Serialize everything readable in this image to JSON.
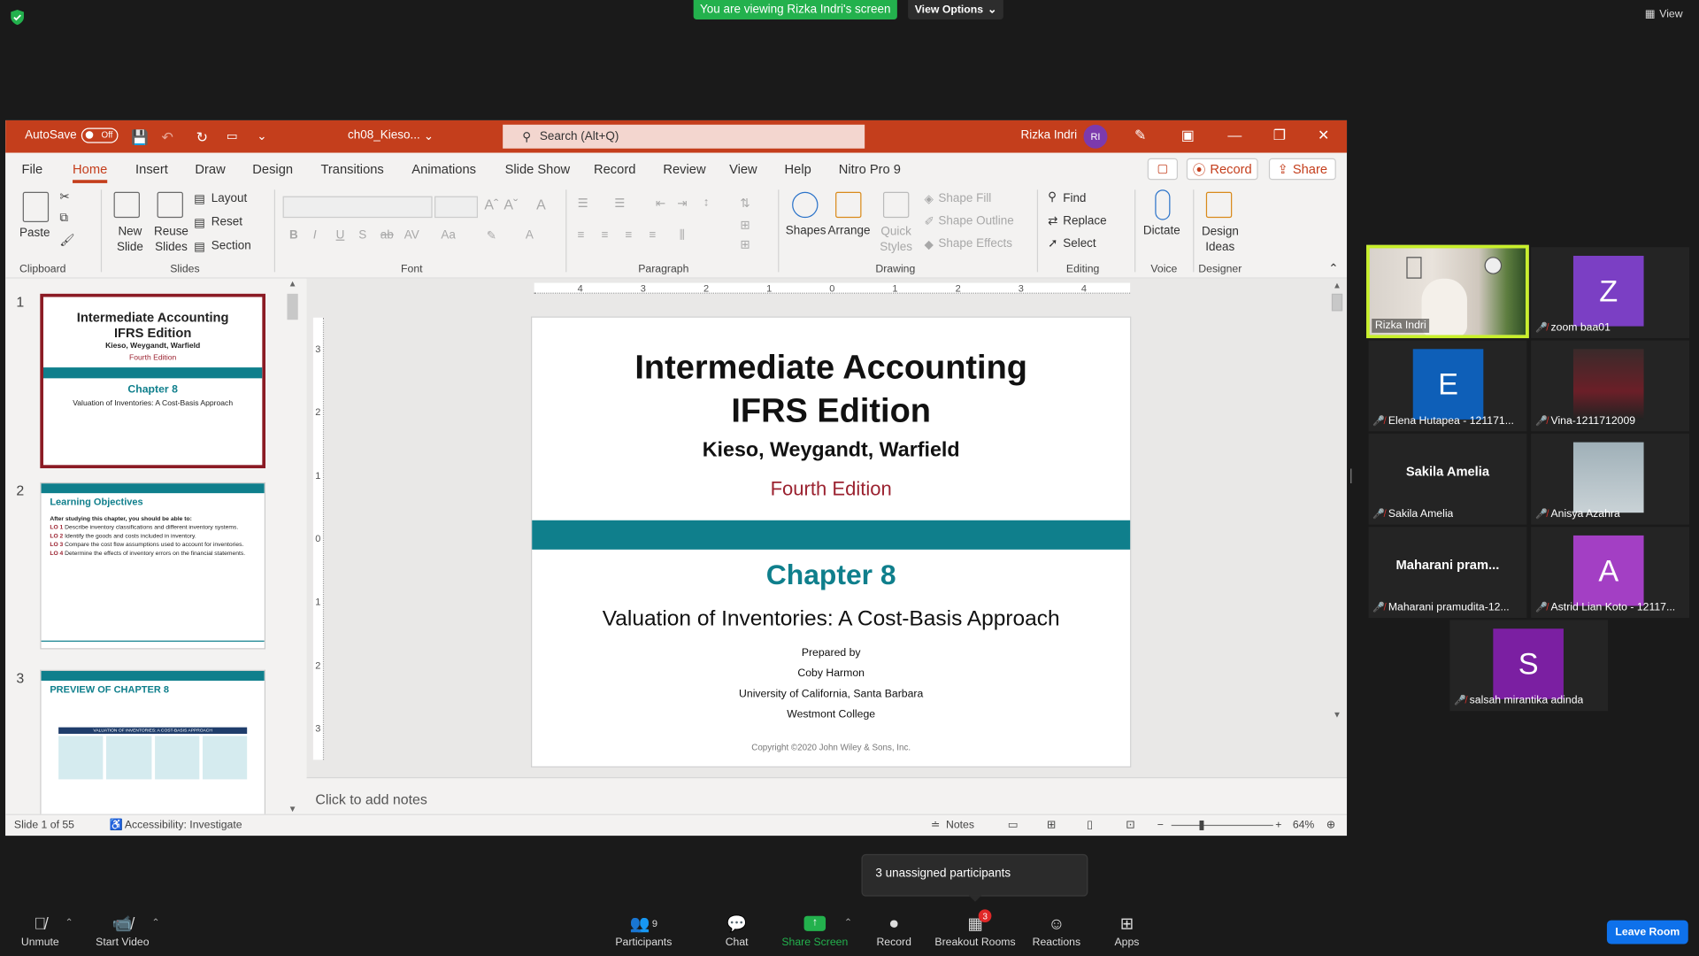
{
  "zoom": {
    "screen_banner": "You are viewing Rizka Indri's screen",
    "view_options": "View Options",
    "view_label": "View",
    "tooltip": "3 unassigned participants",
    "leave_room": "Leave Room",
    "toolbar": {
      "unmute": "Unmute",
      "start_video": "Start Video",
      "participants": "Participants",
      "participants_count": "9",
      "chat": "Chat",
      "share_screen": "Share Screen",
      "record": "Record",
      "breakout_rooms": "Breakout Rooms",
      "breakout_badge": "3",
      "reactions": "Reactions",
      "apps": "Apps"
    },
    "participants": [
      {
        "name": "Rizka Indri",
        "type": "video",
        "active": true
      },
      {
        "name": "zoom baa01",
        "letter": "Z",
        "color": "#7b3fc4",
        "muted": true
      },
      {
        "name": "Elena Hutapea - 121171...",
        "letter": "E",
        "color": "#0e5fb8",
        "muted": true
      },
      {
        "name": "Vina-1211712009",
        "type": "photo",
        "muted": true
      },
      {
        "name": "Sakila Amelia",
        "display": "Sakila Amelia",
        "muted": true
      },
      {
        "name": "Anisya Azahra",
        "type": "photo",
        "muted": true
      },
      {
        "name": "Maharani pramudita-12...",
        "display": "Maharani  pram...",
        "muted": true
      },
      {
        "name": "Astrid Lian Koto - 12117...",
        "letter": "A",
        "color": "#a33fc4",
        "muted": true
      },
      {
        "name": "salsah mirantika adinda",
        "letter": "S",
        "color": "#7b1fa2",
        "muted": true
      }
    ]
  },
  "ppt": {
    "autosave_label": "AutoSave",
    "autosave_state": "Off",
    "filename": "ch08_Kieso...",
    "search_placeholder": "Search (Alt+Q)",
    "user_name": "Rizka Indri",
    "user_initials": "RI",
    "menu": [
      "File",
      "Home",
      "Insert",
      "Draw",
      "Design",
      "Transitions",
      "Animations",
      "Slide Show",
      "Record",
      "Review",
      "View",
      "Help",
      "Nitro Pro 9"
    ],
    "record_btn": "Record",
    "share_btn": "Share",
    "ribbon": {
      "paste": "Paste",
      "clipboard": "Clipboard",
      "new_slide": "New Slide",
      "reuse_slides": "Reuse Slides",
      "layout": "Layout",
      "reset": "Reset",
      "section": "Section",
      "slides": "Slides",
      "font": "Font",
      "paragraph": "Paragraph",
      "shapes": "Shapes",
      "arrange": "Arrange",
      "quick_styles": "Quick Styles",
      "shape_fill": "Shape Fill",
      "shape_outline": "Shape Outline",
      "shape_effects": "Shape Effects",
      "drawing": "Drawing",
      "find": "Find",
      "replace": "Replace",
      "select": "Select",
      "editing": "Editing",
      "dictate": "Dictate",
      "voice": "Voice",
      "design_ideas": "Design Ideas",
      "designer": "Designer"
    },
    "thumbnails": [
      {
        "num": "1",
        "title": "Intermediate Accounting IFRS Edition",
        "authors": "Kieso, Weygandt, Warfield",
        "edition": "Fourth Edition",
        "chapter": "Chapter 8",
        "subtitle": "Valuation of Inventories: A Cost-Basis Approach"
      },
      {
        "num": "2",
        "title": "Learning Objectives",
        "intro": "After studying this chapter, you should be able to:",
        "items": [
          {
            "lo": "LO 1",
            "text": "Describe inventory classifications and different inventory systems."
          },
          {
            "lo": "LO 2",
            "text": "Identify the goods and costs included in inventory."
          },
          {
            "lo": "LO 3",
            "text": "Compare the cost flow assumptions used to account for inventories."
          },
          {
            "lo": "LO 4",
            "text": "Determine the effects of inventory errors on the financial statements."
          }
        ]
      },
      {
        "num": "3",
        "title": "PREVIEW OF CHAPTER 8",
        "banner": "VALUATION OF INVENTORIES: A COST-BASIS APPROACH"
      }
    ],
    "slide": {
      "title_line1": "Intermediate Accounting",
      "title_line2": "IFRS Edition",
      "authors": "Kieso, Weygandt, Warfield",
      "edition": "Fourth Edition",
      "chapter": "Chapter 8",
      "subtitle": "Valuation of Inventories: A Cost-Basis Approach",
      "prepared_by": "Prepared by",
      "preparer": "Coby Harmon",
      "university": "University of California, Santa Barbara",
      "college": "Westmont College",
      "copyright": "Copyright ©2020 John Wiley & Sons, Inc."
    },
    "notes_placeholder": "Click to add notes",
    "status": {
      "slide_count": "Slide 1 of 55",
      "accessibility": "Accessibility: Investigate",
      "notes": "Notes",
      "zoom": "64%"
    },
    "ruler_h": [
      "4",
      "3",
      "2",
      "1",
      "0",
      "1",
      "2",
      "3",
      "4"
    ],
    "ruler_v": [
      "3",
      "2",
      "1",
      "0",
      "1",
      "2",
      "3"
    ]
  },
  "colors": {
    "ppt_red": "#c43e1c",
    "teal": "#0f7f8c",
    "edition_red": "#9b2230",
    "zoom_green": "#23b14d",
    "zoom_blue": "#0e71eb"
  }
}
